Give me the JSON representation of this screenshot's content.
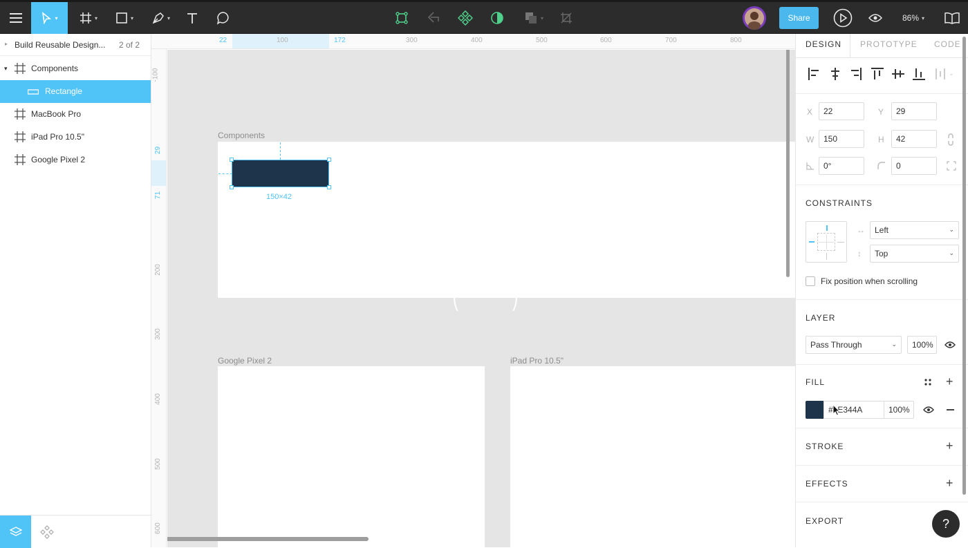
{
  "toolbar": {
    "share_label": "Share",
    "zoom_label": "86%",
    "icons": [
      "menu-icon",
      "move-tool-icon",
      "frame-tool-icon",
      "shape-tool-icon",
      "pen-tool-icon",
      "text-tool-icon",
      "comment-tool-icon",
      "component-icon",
      "detach-icon",
      "components-icon",
      "mask-icon",
      "boolean-icon",
      "crop-icon",
      "avatar",
      "play-icon",
      "eye-icon",
      "library-icon"
    ]
  },
  "layers": {
    "file_name": "Build Reusable Design...",
    "page_counter": "2 of 2",
    "items": [
      {
        "label": "Components",
        "type": "frame"
      },
      {
        "label": "Rectangle",
        "type": "rectangle",
        "selected": true
      },
      {
        "label": "MacBook Pro",
        "type": "frame"
      },
      {
        "label": "iPad Pro 10.5\"",
        "type": "frame"
      },
      {
        "label": "Google Pixel 2",
        "type": "frame"
      }
    ]
  },
  "rulers": {
    "top": [
      "22",
      "100",
      "172",
      "300",
      "400",
      "500",
      "600",
      "700",
      "800"
    ],
    "left": [
      "-100",
      "29",
      "71",
      "200",
      "300",
      "400",
      "500",
      "600"
    ]
  },
  "canvas": {
    "frames": [
      {
        "name": "Components"
      },
      {
        "name": "Google Pixel 2"
      },
      {
        "name": "iPad Pro 10.5\""
      }
    ],
    "selection_size": "150×42",
    "rect_fill": "#1E344A",
    "selection_color": "#50c3f7"
  },
  "inspector": {
    "tabs": [
      "DESIGN",
      "PROTOTYPE",
      "CODE"
    ],
    "active_tab": "DESIGN",
    "x_label": "X",
    "x": "22",
    "y_label": "Y",
    "y": "29",
    "w_label": "W",
    "w": "150",
    "h_label": "H",
    "h": "42",
    "rotation": "0°",
    "radius": "0",
    "constraints_title": "CONSTRAINTS",
    "horizontal_constraint": "Left",
    "vertical_constraint": "Top",
    "fix_position_label": "Fix position when scrolling",
    "layer_title": "LAYER",
    "blend_mode": "Pass Through",
    "layer_opacity": "100%",
    "fill_title": "FILL",
    "fill_hex": "#1E344A",
    "fill_opacity": "100%",
    "fill_color": "#1E344A",
    "stroke_title": "STROKE",
    "effects_title": "EFFECTS",
    "export_title": "EXPORT",
    "help_label": "?"
  }
}
